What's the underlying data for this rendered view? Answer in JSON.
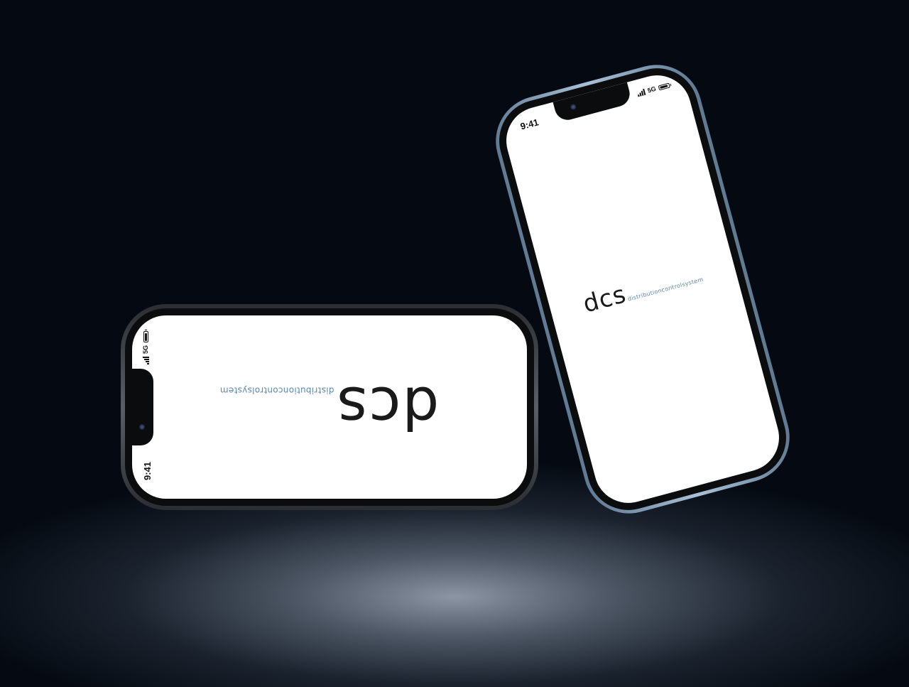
{
  "phones": [
    {
      "status": {
        "time": "9:41",
        "network": "5G",
        "battery_level": 0.9
      },
      "logo": {
        "main": "dcs",
        "sub": "distributioncontrolsystem"
      }
    },
    {
      "status": {
        "time": "9:41",
        "network": "5G",
        "battery_level": 0.9
      },
      "logo": {
        "main": "dcs",
        "sub": "distributioncontrolsystem"
      }
    }
  ],
  "colors": {
    "background": "#050a12",
    "logo_main": "#1a1a1a",
    "logo_sub": "#5f87a8",
    "frame_a": "#5a5f66",
    "frame_b": "#a9c1d6"
  }
}
